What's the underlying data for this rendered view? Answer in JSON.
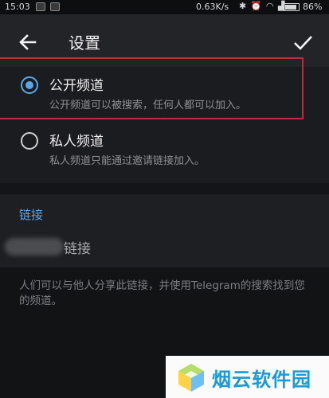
{
  "status_bar": {
    "time": "15:03",
    "network_speed": "0.63K/s",
    "battery_text": "86%",
    "battery_level": 0.86,
    "icons": [
      "bluetooth-icon",
      "alarm-icon",
      "wifi-icon",
      "signal-icon",
      "battery-icon"
    ]
  },
  "app_bar": {
    "title": "设置",
    "back_icon": "arrow-left-icon",
    "confirm_icon": "check-icon"
  },
  "channel_type": {
    "options": [
      {
        "label": "公开频道",
        "description": "公开频道可以被搜索，任何人都可以加入。",
        "selected": true
      },
      {
        "label": "私人频道",
        "description": "私人频道只能通过邀请链接加入。",
        "selected": false
      }
    ]
  },
  "link_section": {
    "header": "链接",
    "value": "链接"
  },
  "info": {
    "text": "人们可以与他人分享此链接，并使用Telegram的搜索找到您的频道。"
  },
  "watermark": {
    "text": "烟云软件园"
  },
  "colors": {
    "accent": "#5aa6e8",
    "highlight": "#b5303a",
    "watermark": "#1a9ad6"
  }
}
